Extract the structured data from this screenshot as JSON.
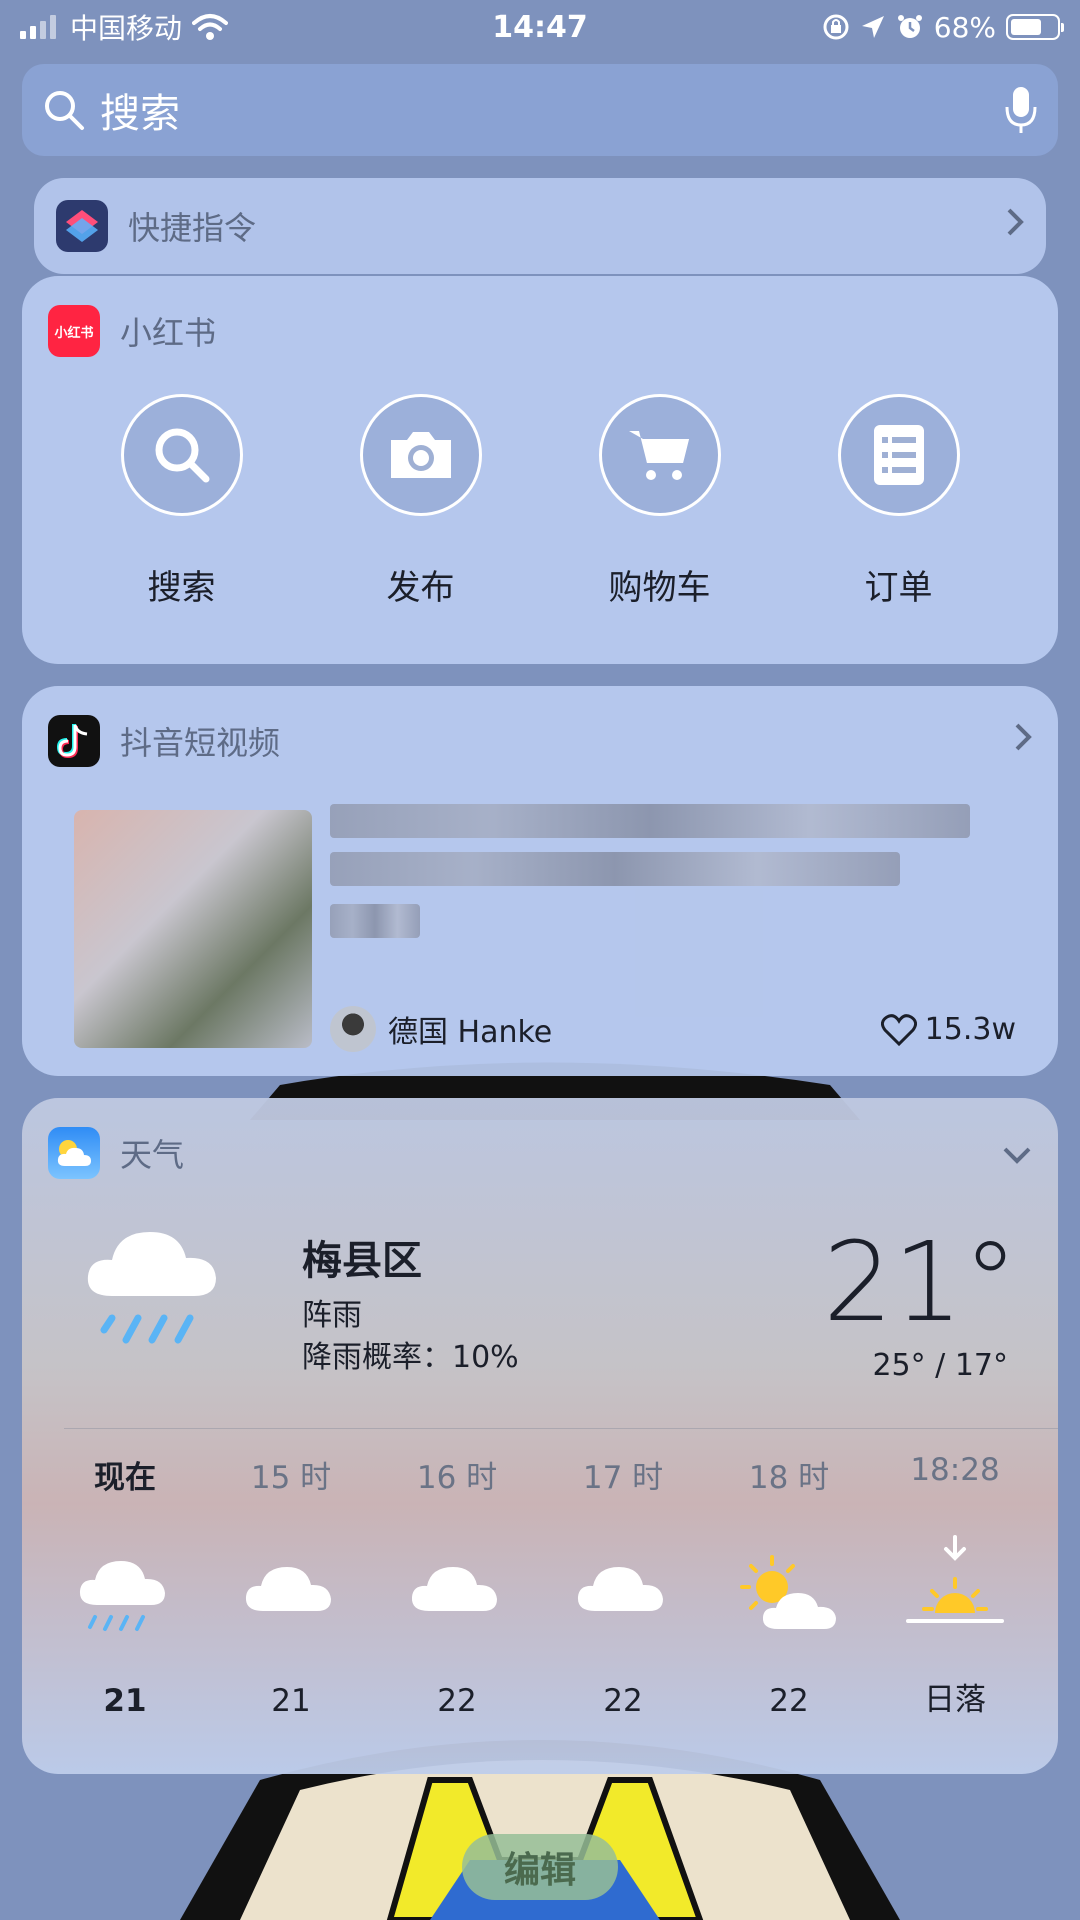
{
  "status_bar": {
    "carrier": "中国移动",
    "time": "14:47",
    "battery_percent": "68%",
    "battery_level": 0.68,
    "icons": [
      "signal-icon",
      "wifi-icon",
      "rotation-lock-icon",
      "location-icon",
      "alarm-icon",
      "battery-icon"
    ]
  },
  "search": {
    "placeholder": "搜索",
    "icons": [
      "search-icon",
      "mic-icon"
    ]
  },
  "shortcuts_widget": {
    "title": "快捷指令"
  },
  "xiaohongshu": {
    "app_name": "小红书",
    "icon_text": "小红书",
    "brand_color": "#ff2442",
    "actions": [
      {
        "label": "搜索",
        "icon": "search-icon"
      },
      {
        "label": "发布",
        "icon": "camera-icon"
      },
      {
        "label": "购物车",
        "icon": "cart-icon"
      },
      {
        "label": "订单",
        "icon": "list-icon"
      }
    ]
  },
  "douyin": {
    "app_name": "抖音短视频",
    "author": "德国 Hanke",
    "likes": "15.3w"
  },
  "weather": {
    "app_name": "天气",
    "city": "梅县区",
    "condition": "阵雨",
    "rain_chance": "降雨概率：10%",
    "temp": "21°",
    "range": "25° / 17°",
    "hours": [
      {
        "label": "现在",
        "icon": "rain-cloud-icon",
        "value": "21"
      },
      {
        "label": "15 时",
        "icon": "cloud-icon",
        "value": "21"
      },
      {
        "label": "16 时",
        "icon": "cloud-icon",
        "value": "22"
      },
      {
        "label": "17 时",
        "icon": "cloud-icon",
        "value": "22"
      },
      {
        "label": "18 时",
        "icon": "partly-sunny-icon",
        "value": "22"
      },
      {
        "label": "18:28",
        "icon": "sunset-icon",
        "value": "日落"
      }
    ]
  },
  "edit_button": {
    "label": "编辑"
  }
}
